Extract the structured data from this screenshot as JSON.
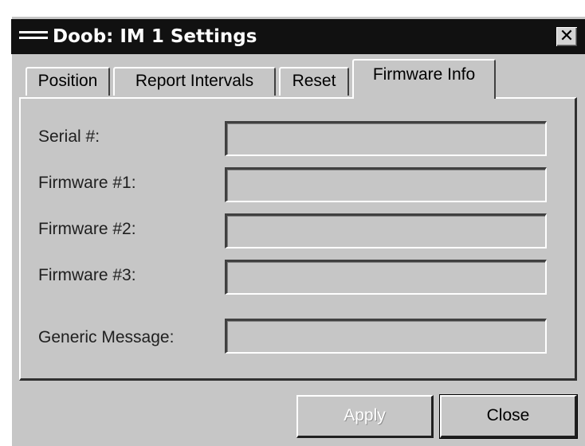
{
  "window": {
    "title": "Doob: IM 1 Settings",
    "icon": "window-menu-icon",
    "close_glyph": "✕"
  },
  "tabs": [
    {
      "label": "Position",
      "active": false
    },
    {
      "label": "Report Intervals",
      "active": false
    },
    {
      "label": "Reset",
      "active": false
    },
    {
      "label": "Firmware Info",
      "active": true
    }
  ],
  "fields": [
    {
      "label": "Serial #:",
      "value": ""
    },
    {
      "label": "Firmware #1:",
      "value": ""
    },
    {
      "label": "Firmware #2:",
      "value": ""
    },
    {
      "label": "Firmware #3:",
      "value": ""
    },
    {
      "label": "Generic Message:",
      "value": ""
    }
  ],
  "buttons": {
    "apply_label": "Apply",
    "apply_enabled": false,
    "close_label": "Close"
  },
  "colors": {
    "titlebar": "#111111",
    "face": "#c6c6c6"
  }
}
